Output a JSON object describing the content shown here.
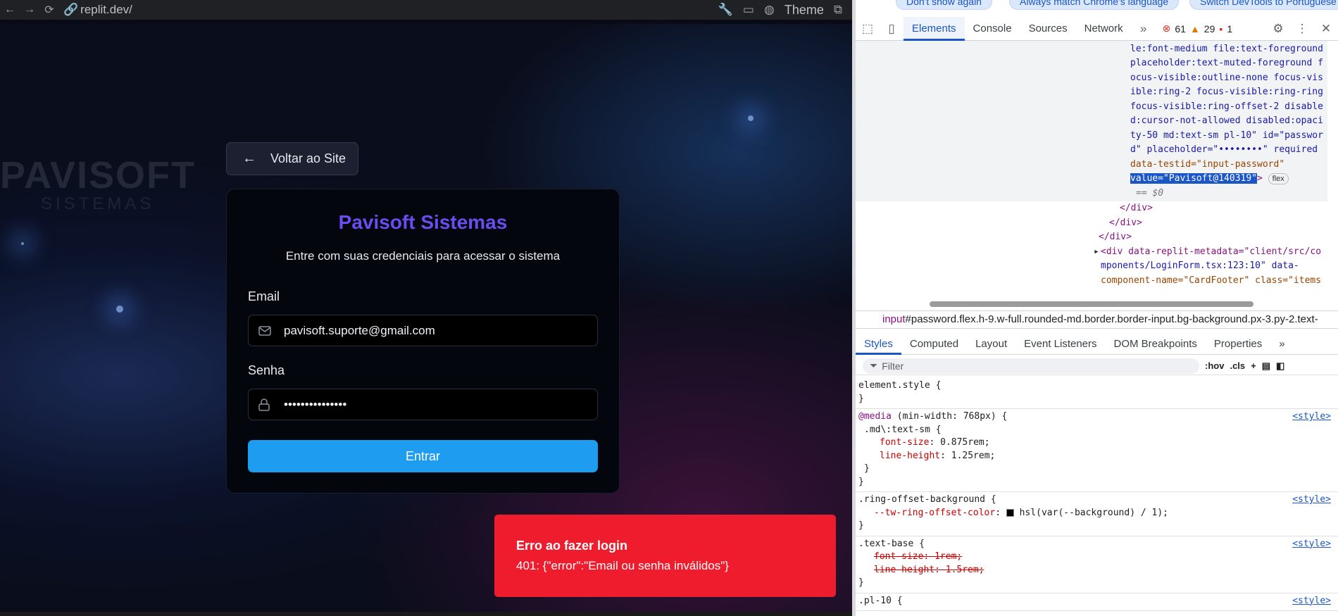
{
  "browser": {
    "url": "replit.dev/",
    "theme_label": "Theme"
  },
  "page": {
    "brand": "PAVISOFT",
    "brand_sub": "SISTEMAS",
    "back_label": "Voltar ao Site",
    "title": "Pavisoft Sistemas",
    "subtitle": "Entre com suas credenciais para acessar o sistema",
    "email_label": "Email",
    "email_value": "pavisoft.suporte@gmail.com",
    "password_label": "Senha",
    "password_value": "•••••••••••••••",
    "submit_label": "Entrar",
    "toast_title": "Erro ao fazer login",
    "toast_message": "401: {\"error\":\"Email ou senha inválidos\"}"
  },
  "devtools": {
    "notice_buttons": [
      "Don't show again",
      "Always match Chrome's language",
      "Switch DevTools to Portuguese"
    ],
    "tabs": [
      "Elements",
      "Console",
      "Sources",
      "Network"
    ],
    "errors": "61",
    "warnings": "29",
    "issues": "1",
    "code_lines": [
      "le:font-medium file:text-foreground",
      "placeholder:text-muted-foreground f",
      "ocus-visible:outline-none focus-vis",
      "ible:ring-2 focus-visible:ring-ring",
      "focus-visible:ring-offset-2 disable",
      "d:cursor-not-allowed disabled:opaci",
      "ty-50 md:text-sm pl-10\" id=\"passwor",
      "d\" placeholder=\"••••••••\" required",
      "data-testid=\"input-password\""
    ],
    "selected_attr": "value=\"Pavisoft@140319\"",
    "flex_badge": "flex",
    "dollar_zero": "== $0",
    "closing_div": "</div>",
    "next_div_lines": [
      "<div data-replit-metadata=\"client/src/co",
      "mponents/LoginForm.tsx:123:10\" data-",
      "component-name=\"CardFooter\" class=\"items"
    ],
    "breadcrumb_tag": "input",
    "breadcrumb_rest": "#password.flex.h-9.w-full.rounded-md.border.border-input.bg-background.px-3.py-2.text-",
    "style_tabs": [
      "Styles",
      "Computed",
      "Layout",
      "Event Listeners",
      "DOM Breakpoints",
      "Properties"
    ],
    "filter_placeholder": "Filter",
    "hov": ":hov",
    "cls": ".cls",
    "style_src": "<style>",
    "rules": {
      "element_style": "element.style {",
      "media": "@media",
      "media_cond": "(min-width: 768px) {",
      "md_selector": ".md\\:text-sm {",
      "md_fs": "font-size",
      "md_fs_v": "0.875rem;",
      "md_lh": "line-height",
      "md_lh_v": "1.25rem;",
      "ring_selector": ".ring-offset-background {",
      "ring_prop": "--tw-ring-offset-color",
      "ring_val": "hsl(var(--background) / 1);",
      "tb_selector": ".text-base {",
      "tb_fs": "font-size: 1rem;",
      "tb_lh": "line-height: 1.5rem;",
      "pl_selector": ".pl-10 {",
      "close": "}"
    }
  }
}
